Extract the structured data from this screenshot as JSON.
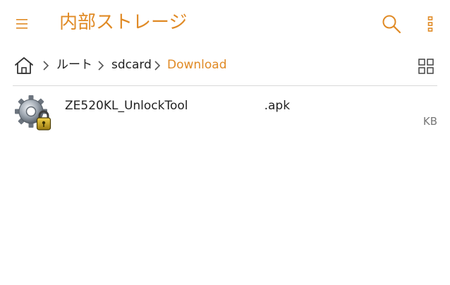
{
  "appbar": {
    "title": "内部ストレージ",
    "accent_color": "#e08a25",
    "icons": [
      "menu-icon",
      "search-icon",
      "more-vert-icon"
    ]
  },
  "breadcrumb": {
    "items": [
      "ルート",
      "sdcard",
      "Download"
    ],
    "active_index": 2,
    "home_icon": "home-icon",
    "view_toggle_icon": "grid-view-icon"
  },
  "files": [
    {
      "name": "ZE520KL_UnlockTool                    .apk",
      "size_unit": "KB",
      "icon": "apk-gear-lock-icon"
    }
  ]
}
